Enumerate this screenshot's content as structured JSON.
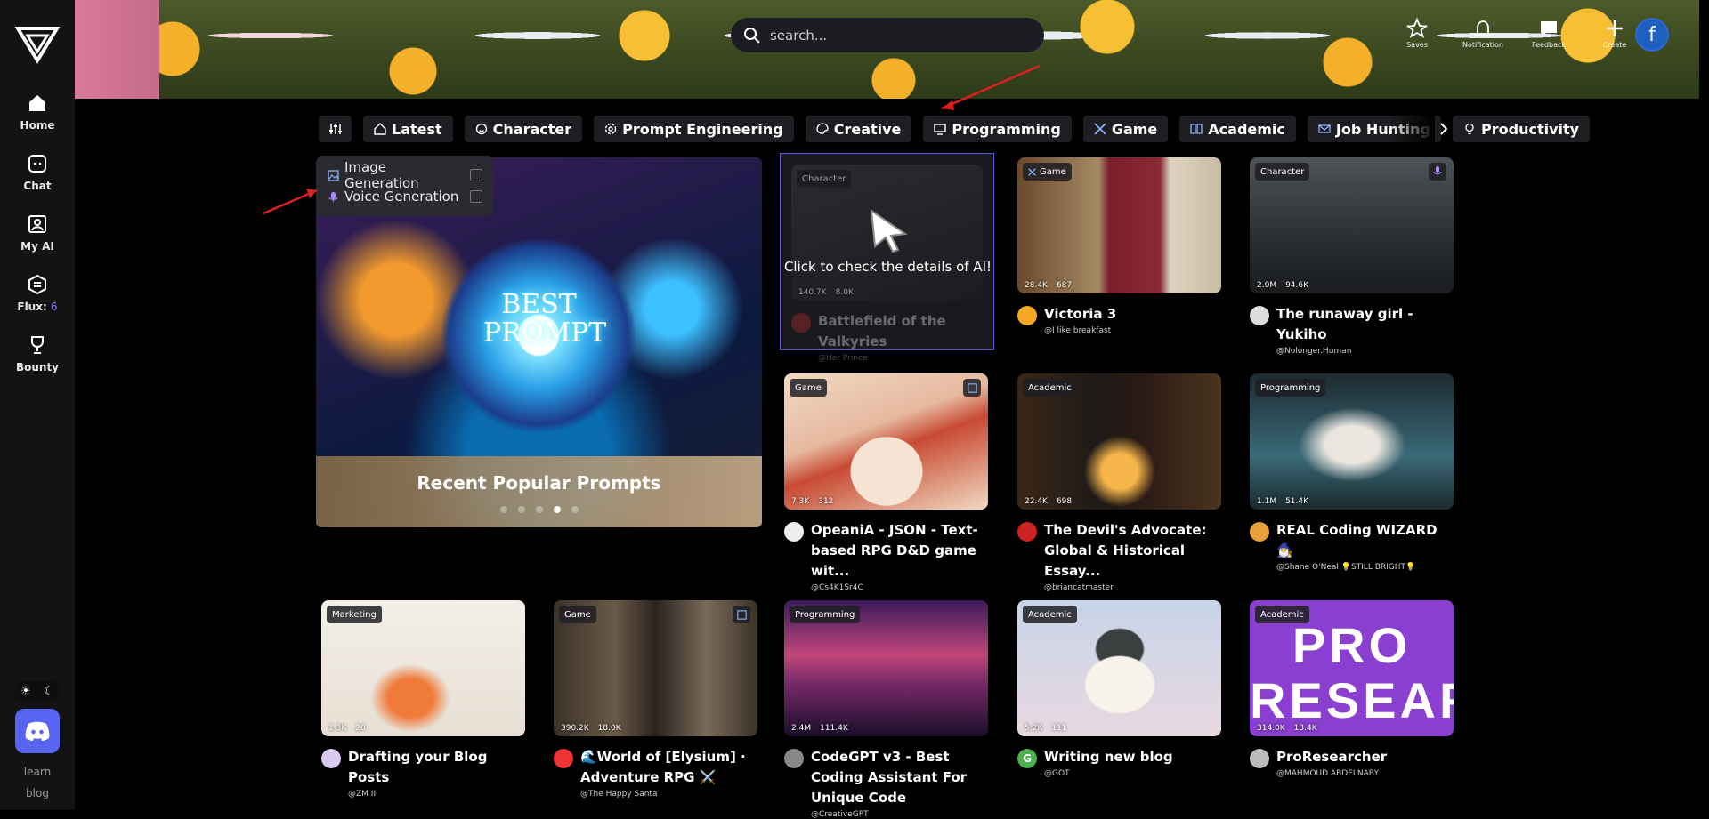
{
  "sidebar": {
    "items": [
      {
        "label": "Home",
        "icon": "home-icon"
      },
      {
        "label": "Chat",
        "icon": "chat-icon"
      },
      {
        "label": "My AI",
        "icon": "my-ai-icon"
      },
      {
        "label": "Flux:",
        "count": "6",
        "icon": "flux-icon"
      },
      {
        "label": "Bounty",
        "icon": "trophy-icon"
      }
    ],
    "links": [
      "learn",
      "blog"
    ]
  },
  "header": {
    "search_placeholder": "search...",
    "actions": [
      {
        "label": "Saves",
        "icon": "star-icon"
      },
      {
        "label": "Notification",
        "icon": "bell-icon"
      },
      {
        "label": "Feedback",
        "icon": "feedback-icon"
      },
      {
        "label": "Create",
        "icon": "plus-icon"
      }
    ],
    "avatar_letter": "f"
  },
  "categories": [
    "Latest",
    "Character",
    "Prompt Engineering",
    "Creative",
    "Programming",
    "Game",
    "Academic",
    "Job Hunting",
    "Productivity"
  ],
  "filter_popup": {
    "options": [
      {
        "label": "Image Generation",
        "checked": false
      },
      {
        "label": "Voice Generation",
        "checked": false
      }
    ]
  },
  "carousel": {
    "image_text": "BEST PROMPT",
    "caption": "Recent Popular Prompts",
    "dots": 5,
    "active_dot": 4
  },
  "featured": {
    "tag": "Character",
    "overlay": "Click to check the details of AI!",
    "stats": [
      "140.7K",
      "8.0K"
    ],
    "title": "Battlefield of the Valkyries",
    "author": "@Her Prince"
  },
  "cards": [
    {
      "tag": "Game",
      "stats": [
        "28.4K",
        "687"
      ],
      "title": "Victoria 3",
      "author": "@I like breakfast"
    },
    {
      "tag": "Character",
      "stats": [
        "2.0M",
        "94.6K"
      ],
      "title": "The runaway girl - Yukiho",
      "author": "@Nolonger.Human"
    },
    {
      "tag": "Game",
      "stats": [
        "7.3K",
        "312"
      ],
      "title": "OpeaniA - JSON - Text-based RPG D&D game wit...",
      "author": "@Cs4K1Sr4C"
    },
    {
      "tag": "Academic",
      "stats": [
        "22.4K",
        "698"
      ],
      "title": "The Devil's Advocate: Global & Historical Essay...",
      "author": "@briancatmaster"
    },
    {
      "tag": "Programming",
      "stats": [
        "1.1M",
        "51.4K"
      ],
      "title": "REAL Coding WIZARD 🧙‍♂️",
      "author": "@Shane O'Neal 💡STILL BRIGHT💡"
    },
    {
      "tag": "Marketing",
      "stats": [
        "1.3K",
        "20"
      ],
      "title": "Drafting your Blog Posts",
      "author": "@ZM III"
    },
    {
      "tag": "Game",
      "stats": [
        "390.2K",
        "18.0K"
      ],
      "title": "🌊World of [Elysium] · Adventure RPG ⚔️",
      "author": "@The Happy Santa"
    },
    {
      "tag": "Programming",
      "stats": [
        "2.4M",
        "111.4K"
      ],
      "title": "CodeGPT v3 - Best Coding Assistant For Unique Code",
      "author": "@CreativeGPT"
    },
    {
      "tag": "Academic",
      "stats": [
        "5.2K",
        "111"
      ],
      "title": "Writing new blog",
      "author": "@GOT",
      "avatar_letter": "G"
    },
    {
      "tag": "Academic",
      "stats": [
        "314.0K",
        "13.4K"
      ],
      "title": "ProResearcher",
      "author": "@MAHMOUD ABDELNABY",
      "image_text": "PRO RESEARCHER"
    }
  ],
  "colors": {
    "accent": "#5a58d6",
    "discord": "#5865f2",
    "sidebar_bg": "#131316",
    "chip_bg": "#1e1e22"
  }
}
